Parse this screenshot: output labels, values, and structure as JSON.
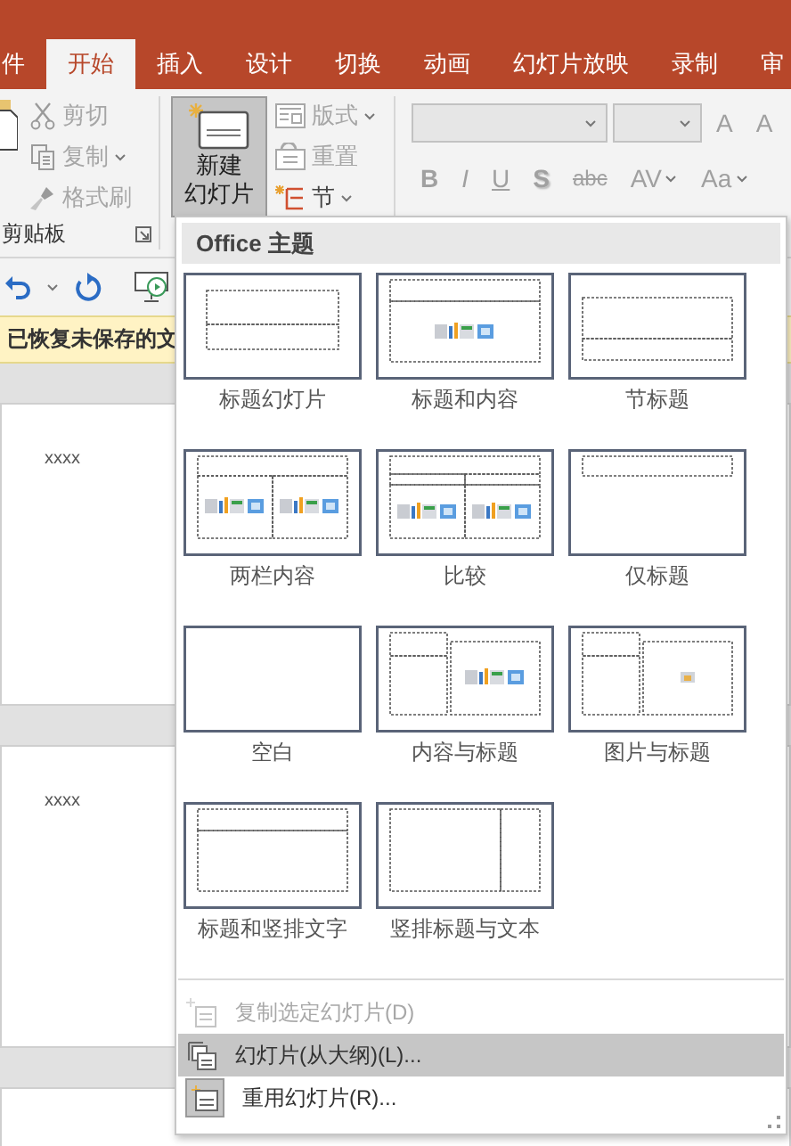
{
  "tabs": [
    {
      "label": "件",
      "selected": false
    },
    {
      "label": "开始",
      "selected": true
    },
    {
      "label": "插入",
      "selected": false
    },
    {
      "label": "设计",
      "selected": false
    },
    {
      "label": "切换",
      "selected": false
    },
    {
      "label": "动画",
      "selected": false
    },
    {
      "label": "幻灯片放映",
      "selected": false
    },
    {
      "label": "录制",
      "selected": false
    },
    {
      "label": "审",
      "selected": false
    }
  ],
  "clipboard": {
    "items": [
      {
        "kind": "cut",
        "label": "剪切",
        "disabled": true
      },
      {
        "kind": "copy",
        "label": "复制",
        "disabled": true
      },
      {
        "kind": "brush",
        "label": "格式刷",
        "disabled": true
      }
    ],
    "group_label": "剪贴板"
  },
  "slides_group": {
    "new_slide": {
      "lines": [
        "新建",
        "幻灯片"
      ],
      "pressed": true
    },
    "items": [
      {
        "kind": "layout",
        "label": "版式",
        "disabled": true
      },
      {
        "kind": "reset",
        "label": "重置",
        "disabled": true
      },
      {
        "kind": "section",
        "label": "节",
        "disabled": false
      }
    ]
  },
  "font_group": {
    "disabled": true,
    "size_buttons": [
      "A",
      "A"
    ],
    "format_buttons": [
      "B",
      "I",
      "U",
      "S",
      "abc",
      "AV",
      "Aa"
    ]
  },
  "notification": "已恢复未保存的文",
  "slides": [
    {
      "kind": "text",
      "text": "xxxx"
    },
    {
      "kind": "text",
      "text": "xxxx"
    },
    {
      "kind": "empty"
    }
  ],
  "menu": {
    "header": "Office 主题",
    "layouts": [
      {
        "label": "标题幻灯片",
        "kind": "title"
      },
      {
        "label": "标题和内容",
        "kind": "title_content"
      },
      {
        "label": "节标题",
        "kind": "section"
      },
      {
        "label": "两栏内容",
        "kind": "two_content"
      },
      {
        "label": "比较",
        "kind": "comparison"
      },
      {
        "label": "仅标题",
        "kind": "title_only"
      },
      {
        "label": "空白",
        "kind": "blank"
      },
      {
        "label": "内容与标题",
        "kind": "content_caption"
      },
      {
        "label": "图片与标题",
        "kind": "picture_caption"
      },
      {
        "label": "标题和竖排文字",
        "kind": "vertical_text"
      },
      {
        "label": "竖排标题与文本",
        "kind": "vertical_title"
      }
    ],
    "commands": [
      {
        "kind": "duplicate",
        "label": "复制选定幻灯片(D)",
        "disabled": true,
        "selected": false
      },
      {
        "kind": "outline",
        "label": "幻灯片(从大纲)(L)...",
        "disabled": false,
        "selected": true
      },
      {
        "kind": "reuse",
        "label": "重用幻灯片(R)...",
        "disabled": false,
        "selected": false
      }
    ]
  }
}
